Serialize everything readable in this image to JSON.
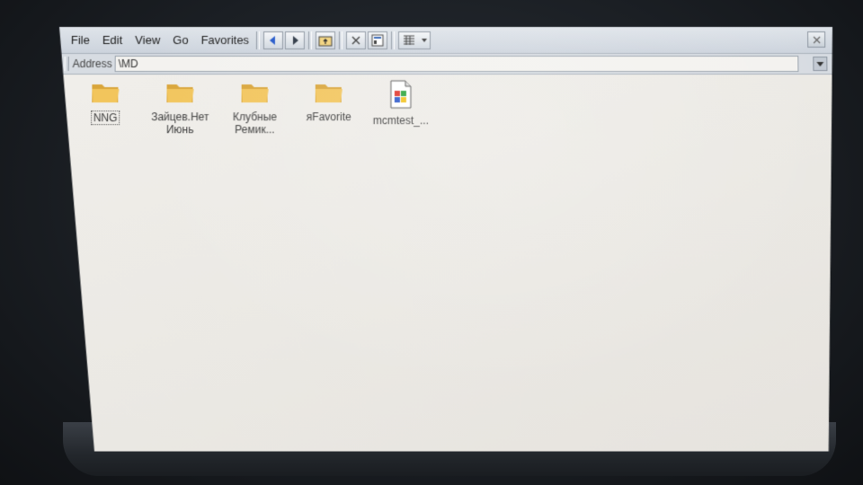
{
  "menu": {
    "items": [
      "File",
      "Edit",
      "View",
      "Go",
      "Favorites"
    ]
  },
  "toolbar": {
    "buttons": [
      "back-icon",
      "forward-icon",
      "up-folder-icon",
      "delete-icon",
      "properties-icon",
      "views-icon"
    ]
  },
  "address": {
    "label": "Address",
    "value": "\\MD"
  },
  "files": [
    {
      "name": "NNG",
      "type": "folder",
      "selected": true
    },
    {
      "name": "Зайцев.Нет\nИюнь",
      "type": "folder",
      "selected": false
    },
    {
      "name": "Клубные\nРемик...",
      "type": "folder",
      "selected": false
    },
    {
      "name": "яFavorite",
      "type": "folder",
      "selected": false
    },
    {
      "name": "mcmtest_...",
      "type": "document",
      "selected": false
    }
  ],
  "colors": {
    "folder": "#f2c55c",
    "folder_dark": "#d9a53a",
    "accent": "#1c3f8c"
  }
}
